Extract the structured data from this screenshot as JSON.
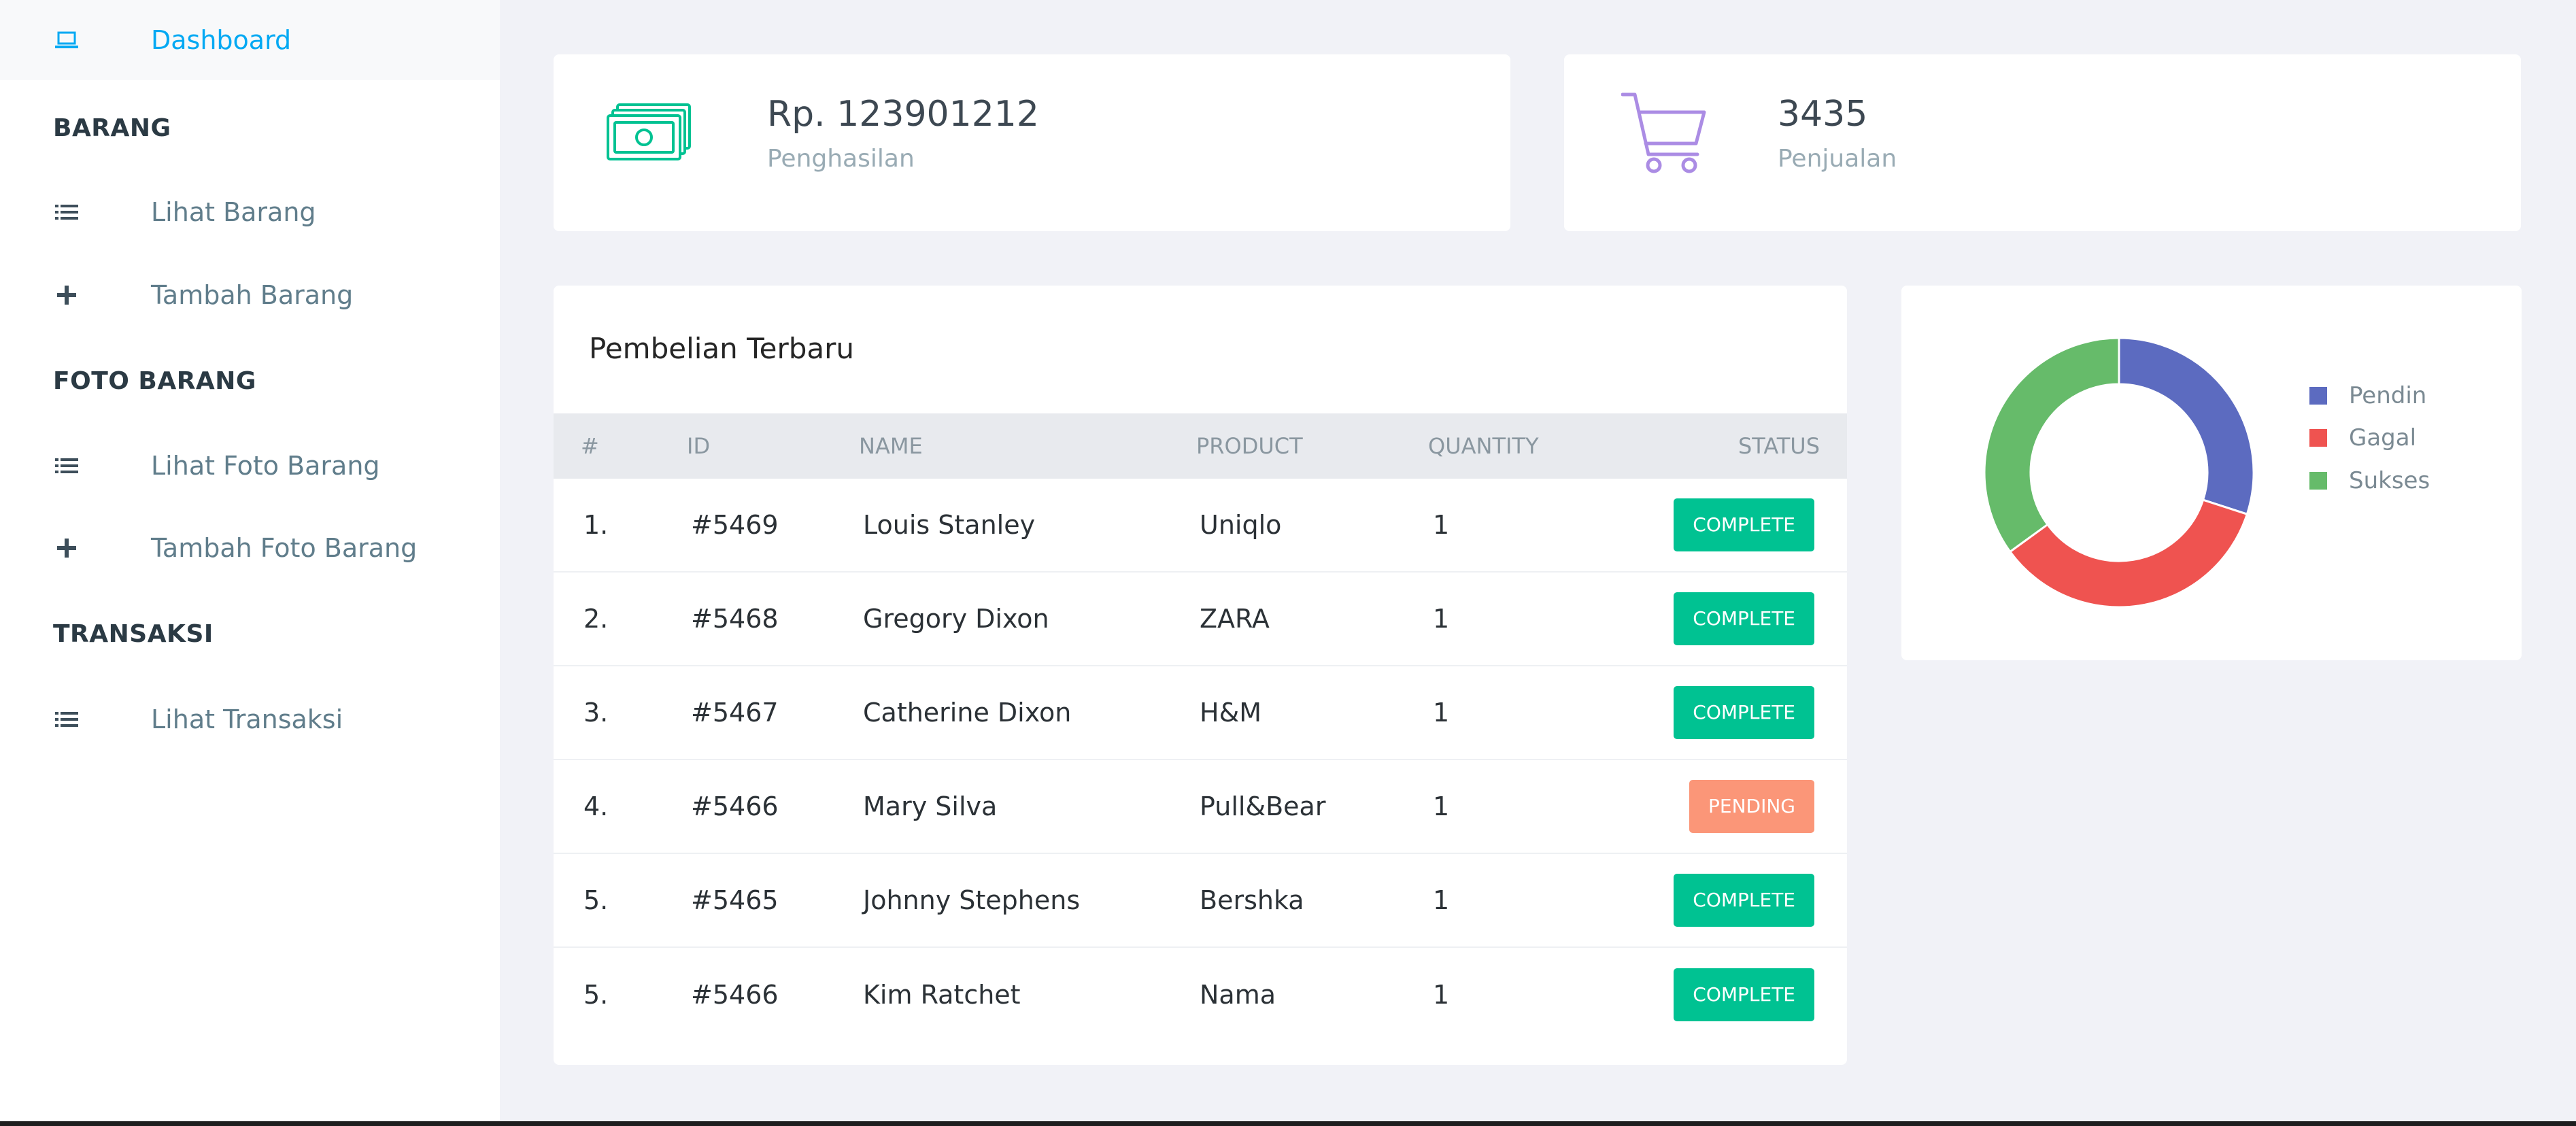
{
  "sidebar": {
    "items": [
      {
        "type": "link",
        "label": "Dashboard",
        "icon": "laptop-icon",
        "active": true
      },
      {
        "type": "header",
        "label": "BARANG"
      },
      {
        "type": "link",
        "label": "Lihat Barang",
        "icon": "list-icon"
      },
      {
        "type": "link",
        "label": "Tambah Barang",
        "icon": "plus-icon"
      },
      {
        "type": "header",
        "label": "FOTO BARANG"
      },
      {
        "type": "link",
        "label": "Lihat Foto Barang",
        "icon": "list-icon"
      },
      {
        "type": "link",
        "label": "Tambah Foto Barang",
        "icon": "plus-icon"
      },
      {
        "type": "header",
        "label": "TRANSAKSI"
      },
      {
        "type": "link",
        "label": "Lihat Transaksi",
        "icon": "list-icon"
      }
    ]
  },
  "stats": [
    {
      "value": "Rp. 123901212",
      "label": "Penghasilan",
      "icon": "money-icon",
      "color": "#00c292"
    },
    {
      "value": "3435",
      "label": "Penjualan",
      "icon": "cart-icon",
      "color": "#ab8ce4"
    }
  ],
  "purchases": {
    "title": "Pembelian Terbaru",
    "columns": [
      "#",
      "ID",
      "NAME",
      "PRODUCT",
      "QUANTITY",
      "STATUS"
    ],
    "rows": [
      {
        "no": "1.",
        "id": "#5469",
        "name": "Louis Stanley",
        "product": "Uniqlo",
        "qty": "1",
        "status": "COMPLETE"
      },
      {
        "no": "2.",
        "id": "#5468",
        "name": "Gregory Dixon",
        "product": "ZARA",
        "qty": "1",
        "status": "COMPLETE"
      },
      {
        "no": "3.",
        "id": "#5467",
        "name": "Catherine Dixon",
        "product": "H&M",
        "qty": "1",
        "status": "COMPLETE"
      },
      {
        "no": "4.",
        "id": "#5466",
        "name": "Mary Silva",
        "product": "Pull&Bear",
        "qty": "1",
        "status": "PENDING"
      },
      {
        "no": "5.",
        "id": "#5465",
        "name": "Johnny Stephens",
        "product": "Bershka",
        "qty": "1",
        "status": "COMPLETE"
      },
      {
        "no": "5.",
        "id": "#5466",
        "name": "Kim Ratchet",
        "product": "Nama",
        "qty": "1",
        "status": "COMPLETE"
      }
    ],
    "status_colors": {
      "COMPLETE": "#00c292",
      "PENDING": "#fb9678"
    }
  },
  "chart_data": {
    "type": "pie",
    "donut": true,
    "legend_position": "right",
    "categories": [
      "Pendin",
      "Gagal",
      "Sukses"
    ],
    "values": [
      30,
      35,
      35
    ],
    "colors": [
      "#5c6bc0",
      "#ef5350",
      "#66bb6a"
    ]
  }
}
